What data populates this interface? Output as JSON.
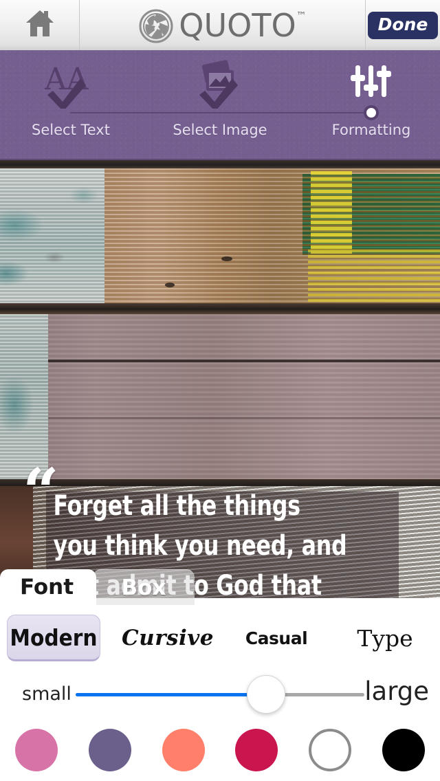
{
  "header": {
    "home_icon": "home-icon",
    "logo_icon": "camera-aperture-icon",
    "logo_text": "QUOTO",
    "trademark": "™",
    "done_label": "Done"
  },
  "stepper": {
    "accent_bg": "#755f90",
    "track_color": "#5b4874",
    "steps": [
      {
        "label": "Select Text",
        "icon": "text-aa-check-icon",
        "state": "complete"
      },
      {
        "label": "Select Image",
        "icon": "photo-check-icon",
        "state": "complete"
      },
      {
        "label": "Formatting",
        "icon": "sliders-icon",
        "state": "active"
      }
    ]
  },
  "canvas": {
    "quote_text": "Forget all the things you think you need, and just admit to God that you need Him.",
    "open_quote": "“",
    "close_quote": "”",
    "box_color": "rgba(38,26,30,0.47)",
    "text_color": "#ffffff"
  },
  "tabs": [
    {
      "label": "Font",
      "active": true
    },
    {
      "label": "Box",
      "active": false
    }
  ],
  "panel": {
    "fonts": [
      {
        "label": "Modern",
        "selected": true
      },
      {
        "label": "Cursive",
        "selected": false
      },
      {
        "label": "Casual",
        "selected": false
      },
      {
        "label": "Type",
        "selected": false
      }
    ],
    "size_slider": {
      "min_label": "small",
      "max_label": "large",
      "value_percent": 66,
      "fill_color": "#0a74f0",
      "track_color": "#a8a8a8"
    },
    "colors": [
      {
        "name": "pink",
        "hex": "#d873a8",
        "selected": false
      },
      {
        "name": "purple",
        "hex": "#6b5f8c",
        "selected": false
      },
      {
        "name": "coral",
        "hex": "#ff7f6b",
        "selected": false
      },
      {
        "name": "crimson",
        "hex": "#c9164f",
        "selected": false
      },
      {
        "name": "white",
        "hex": "#ffffff",
        "selected": false
      },
      {
        "name": "black",
        "hex": "#000000",
        "selected": false
      }
    ]
  }
}
